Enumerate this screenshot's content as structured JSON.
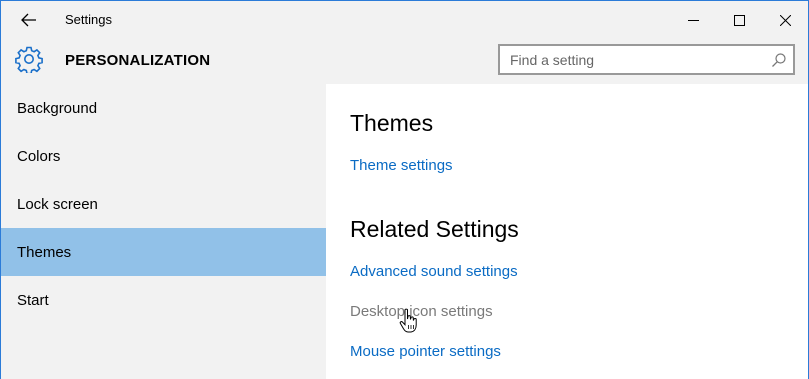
{
  "window": {
    "title": "Settings",
    "controls": {
      "minimize": "minimize",
      "maximize": "maximize",
      "close": "close"
    }
  },
  "header": {
    "title": "PERSONALIZATION",
    "icon": "gear-icon",
    "search": {
      "placeholder": "Find a setting",
      "value": ""
    }
  },
  "sidebar": {
    "items": [
      {
        "label": "Background",
        "selected": false
      },
      {
        "label": "Colors",
        "selected": false
      },
      {
        "label": "Lock screen",
        "selected": false
      },
      {
        "label": "Themes",
        "selected": true
      },
      {
        "label": "Start",
        "selected": false
      }
    ]
  },
  "main": {
    "themes_heading": "Themes",
    "theme_settings_link": "Theme settings",
    "related_heading": "Related Settings",
    "related_links": [
      {
        "label": "Advanced sound settings",
        "enabled": true
      },
      {
        "label": "Desktop icon settings",
        "enabled": false
      },
      {
        "label": "Mouse pointer settings",
        "enabled": true
      }
    ]
  },
  "colors": {
    "accent": "#0a6bc4",
    "selected_nav": "#91c1e8",
    "chrome_bg": "#f2f2f2"
  }
}
